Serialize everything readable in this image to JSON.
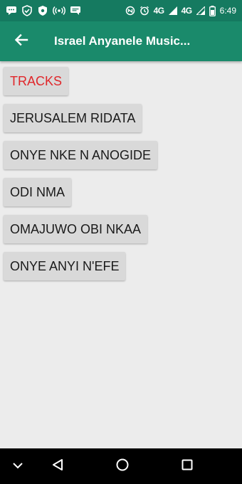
{
  "status_bar": {
    "network_1": "4G",
    "network_2": "4G",
    "time": "6:49"
  },
  "app_bar": {
    "title": "Israel Anyanele Music...",
    "back_icon": "arrow-back-icon"
  },
  "tracks": {
    "header_label": "TRACKS",
    "items": [
      "JERUSALEM RIDATA",
      "ONYE NKE N ANOGIDE",
      "ODI NMA",
      "OMAJUWO OBI NKAA",
      "ONYE ANYI N'EFE"
    ]
  },
  "nav_bar": {
    "icons": [
      "chevron-down-icon",
      "back-triangle-icon",
      "home-circle-icon",
      "recents-square-icon"
    ]
  },
  "colors": {
    "status_bar": "#157a60",
    "app_bar": "#1a8a6b",
    "background": "#ececec",
    "button": "#d9d9d9",
    "header_text": "#e0262a"
  }
}
